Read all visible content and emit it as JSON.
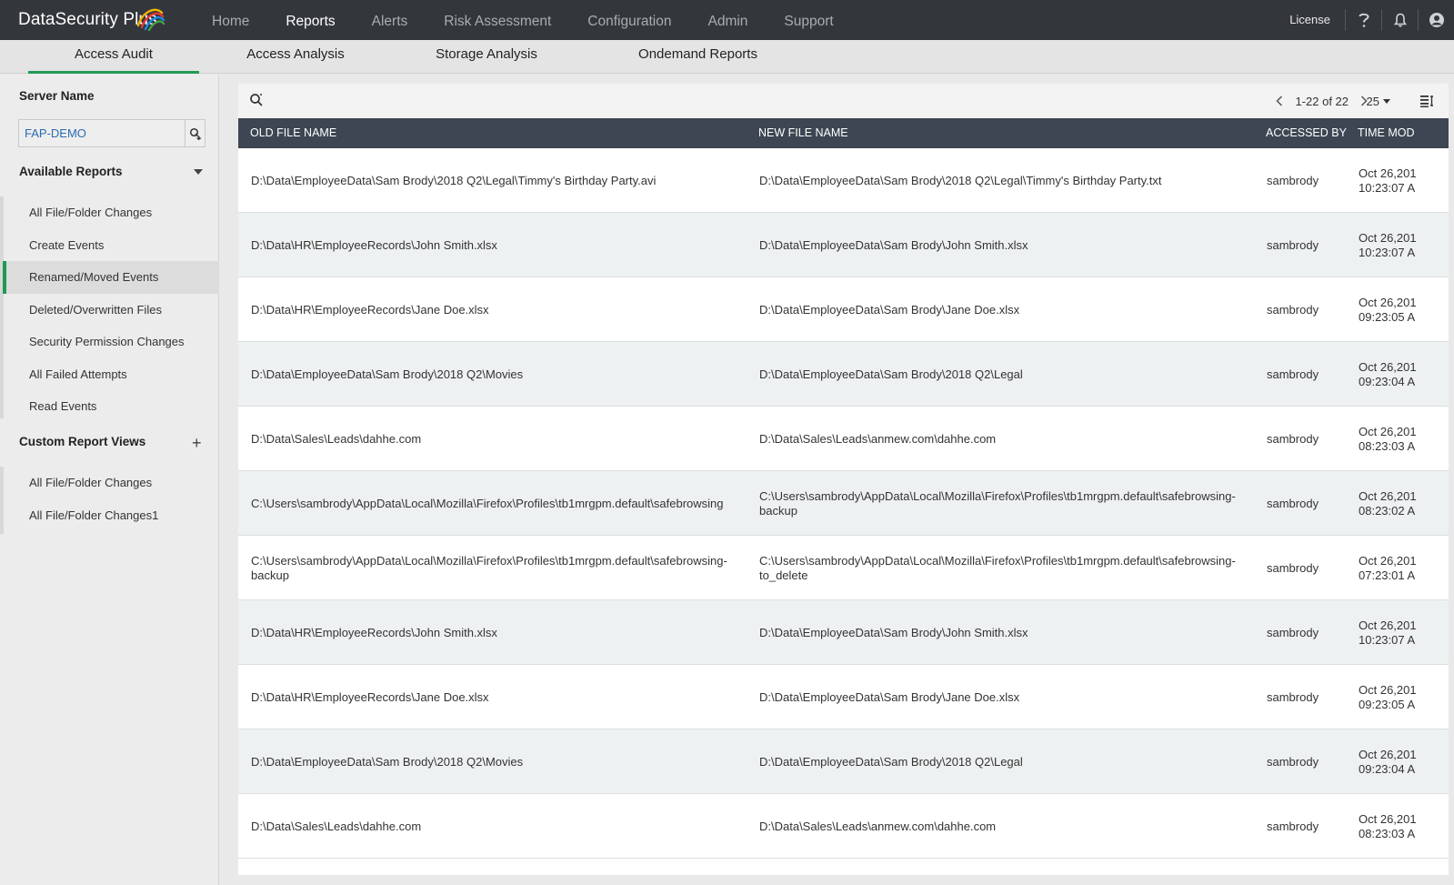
{
  "app": {
    "brand": "DataSecurity Plus",
    "accent_color": "#1f9a55",
    "topbar_color": "#33373c"
  },
  "nav": {
    "items": [
      "Home",
      "Reports",
      "Alerts",
      "Risk Assessment",
      "Configuration",
      "Admin",
      "Support"
    ],
    "active": "Reports"
  },
  "top_right": {
    "license": "License",
    "help_icon": "question-icon",
    "bell_icon": "bell-icon",
    "user_icon": "user-avatar-icon"
  },
  "subtabs": {
    "items": [
      "Access Audit",
      "Access Analysis",
      "Storage Analysis",
      "Ondemand Reports"
    ],
    "active": "Access Audit"
  },
  "sidebar": {
    "server_label": "Server Name",
    "server_value": "FAP-DEMO",
    "available_label": "Available Reports",
    "available_items": [
      "All File/Folder Changes",
      "Create Events",
      "Renamed/Moved Events",
      "Deleted/Overwritten Files",
      "Security Permission Changes",
      "All Failed Attempts",
      "Read Events"
    ],
    "active_item": "Renamed/Moved Events",
    "custom_label": "Custom Report Views",
    "custom_items": [
      "All File/Folder Changes",
      "All File/Folder Changes1"
    ]
  },
  "toolbar": {
    "pager_text": "1-22 of 22",
    "per_page": "25"
  },
  "table": {
    "headers": {
      "old": "OLD FILE NAME",
      "new": "NEW FILE NAME",
      "accessed": "ACCESSED BY",
      "time": "TIME MOD"
    },
    "rows": [
      {
        "old": "D:\\Data\\EmployeeData\\Sam Brody\\2018 Q2\\Legal\\Timmy's Birthday Party.avi",
        "new": "D:\\Data\\EmployeeData\\Sam Brody\\2018 Q2\\Legal\\Timmy's Birthday Party.txt",
        "by": "sambrody",
        "date": "Oct 26,201",
        "time": "10:23:07 A"
      },
      {
        "old": "D:\\Data\\HR\\EmployeeRecords\\John Smith.xlsx",
        "new": "D:\\Data\\EmployeeData\\Sam Brody\\John Smith.xlsx",
        "by": "sambrody",
        "date": "Oct 26,201",
        "time": "10:23:07 A"
      },
      {
        "old": "D:\\Data\\HR\\EmployeeRecords\\Jane Doe.xlsx",
        "new": "D:\\Data\\EmployeeData\\Sam Brody\\Jane Doe.xlsx",
        "by": "sambrody",
        "date": "Oct 26,201",
        "time": "09:23:05 A"
      },
      {
        "old": "D:\\Data\\EmployeeData\\Sam Brody\\2018 Q2\\Movies",
        "new": "D:\\Data\\EmployeeData\\Sam Brody\\2018 Q2\\Legal",
        "by": "sambrody",
        "date": "Oct 26,201",
        "time": "09:23:04 A"
      },
      {
        "old": "D:\\Data\\Sales\\Leads\\dahhe.com",
        "new": "D:\\Data\\Sales\\Leads\\anmew.com\\dahhe.com",
        "by": "sambrody",
        "date": "Oct 26,201",
        "time": "08:23:03 A"
      },
      {
        "old": "C:\\Users\\sambrody\\AppData\\Local\\Mozilla\\Firefox\\Profiles\\tb1mrgpm.default\\safebrowsing",
        "new": "C:\\Users\\sambrody\\AppData\\Local\\Mozilla\\Firefox\\Profiles\\tb1mrgpm.default\\safebrowsing-backup",
        "by": "sambrody",
        "date": "Oct 26,201",
        "time": "08:23:02 A"
      },
      {
        "old": "C:\\Users\\sambrody\\AppData\\Local\\Mozilla\\Firefox\\Profiles\\tb1mrgpm.default\\safebrowsing-backup",
        "new": "C:\\Users\\sambrody\\AppData\\Local\\Mozilla\\Firefox\\Profiles\\tb1mrgpm.default\\safebrowsing-to_delete",
        "by": "sambrody",
        "date": "Oct 26,201",
        "time": "07:23:01 A"
      },
      {
        "old": "D:\\Data\\HR\\EmployeeRecords\\John Smith.xlsx",
        "new": "D:\\Data\\EmployeeData\\Sam Brody\\John Smith.xlsx",
        "by": "sambrody",
        "date": "Oct 26,201",
        "time": "10:23:07 A"
      },
      {
        "old": "D:\\Data\\HR\\EmployeeRecords\\Jane Doe.xlsx",
        "new": "D:\\Data\\EmployeeData\\Sam Brody\\Jane Doe.xlsx",
        "by": "sambrody",
        "date": "Oct 26,201",
        "time": "09:23:05 A"
      },
      {
        "old": "D:\\Data\\EmployeeData\\Sam Brody\\2018 Q2\\Movies",
        "new": "D:\\Data\\EmployeeData\\Sam Brody\\2018 Q2\\Legal",
        "by": "sambrody",
        "date": "Oct 26,201",
        "time": "09:23:04 A"
      },
      {
        "old": "D:\\Data\\Sales\\Leads\\dahhe.com",
        "new": "D:\\Data\\Sales\\Leads\\anmew.com\\dahhe.com",
        "by": "sambrody",
        "date": "Oct 26,201",
        "time": "08:23:03 A"
      }
    ]
  }
}
